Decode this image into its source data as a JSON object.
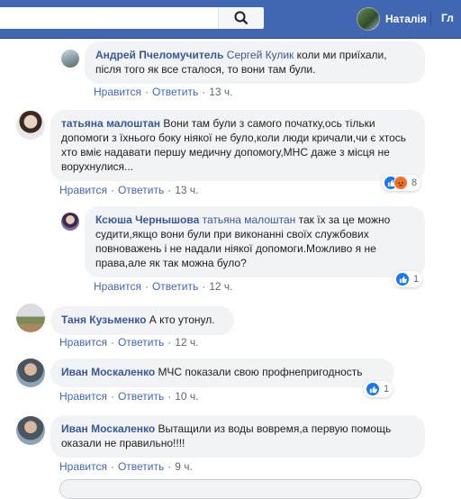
{
  "header": {
    "user_name": "Наталія",
    "cut_label": "Гл"
  },
  "comments": [
    {
      "author": "Андрей Пчеломучитель",
      "reply_to": "Сергей Кулик",
      "text": " коли ми приїхали, після того як все сталося, то вони там були.",
      "like": "Нравится",
      "reply": "Ответить",
      "time": "13 ч."
    },
    {
      "author": "татьяна малоштан",
      "text": "Вони там були з самого початку,ось тільки допомоги з їхнього боку ніякої не було,коли люди кричали,чи є хтось хто вміє надавати першу медичну допомогу,МНС даже з місця не ворухнулися...",
      "like": "Нравится",
      "reply": "Ответить",
      "time": "13 ч.",
      "reactions": "8"
    },
    {
      "author": "Ксюша Чернышова",
      "reply_to": "татьяна малоштан",
      "text": " так їх за це можно судити,якщо вони були при виконанні своїх службових повноважень і не надали ніякої допомоги.Можливо я не права,але як так можна було?",
      "like": "Нравится",
      "reply": "Ответить",
      "time": "12 ч.",
      "reactions": "1"
    },
    {
      "author": "Таня Кузьменко",
      "text": "А кто утонул.",
      "like": "Нравится",
      "reply": "Ответить",
      "time": "12 ч."
    },
    {
      "author": "Иван Москаленко",
      "text": "МЧС показали свою профнепригодность",
      "like": "Нравится",
      "reply": "Ответить",
      "time": "10 ч.",
      "reactions": "1"
    },
    {
      "author": "Иван Москаленко",
      "text": "Вытащили из воды вовремя,а первую помощь оказали не правильно!!!!",
      "like": "Нравится",
      "reply": "Ответить",
      "time": "9 ч."
    }
  ],
  "colors": {
    "facebook_blue": "#4267b2",
    "link": "#385898",
    "bubble": "#f2f3f5"
  }
}
